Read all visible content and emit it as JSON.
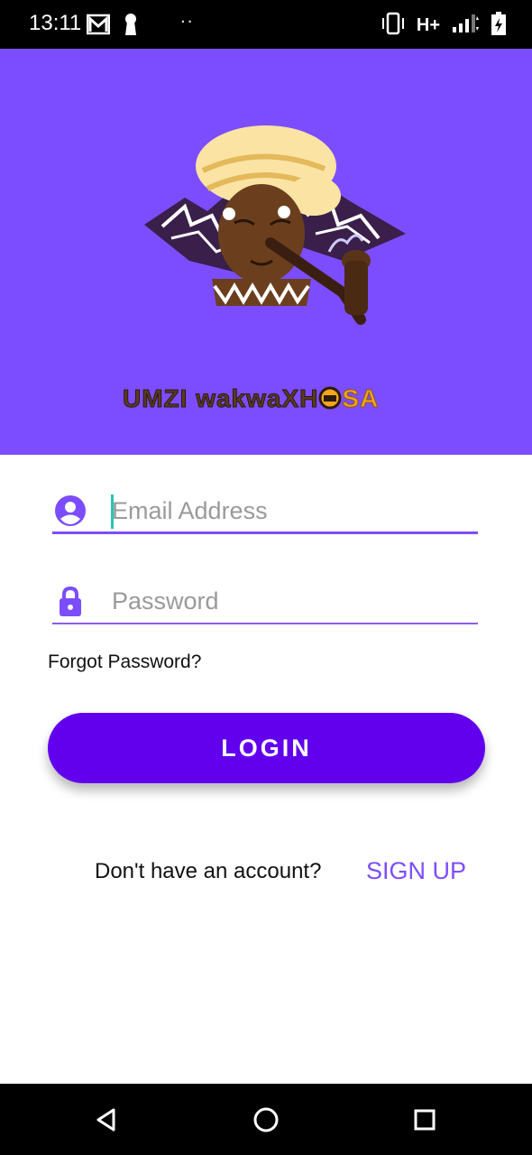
{
  "status_bar": {
    "time": "13:11",
    "network": "H+",
    "icons": [
      "gmail-icon",
      "keyhole-icon",
      "vibrate-icon",
      "signal-icon",
      "battery-icon"
    ]
  },
  "header": {
    "background": "#7c4dff",
    "logo_text_dark": "UMZI wakwaXH",
    "logo_text_gold": "SA"
  },
  "form": {
    "email": {
      "placeholder": "Email Address",
      "value": ""
    },
    "password": {
      "placeholder": "Password",
      "value": ""
    },
    "forgot_label": "Forgot Password?",
    "login_label": "LOGIN"
  },
  "signup": {
    "prompt": "Don't have an account?",
    "link_label": "SIGN UP"
  },
  "colors": {
    "accent": "#7c4dff",
    "button": "#6200ee",
    "cursor": "#26c6b0"
  }
}
